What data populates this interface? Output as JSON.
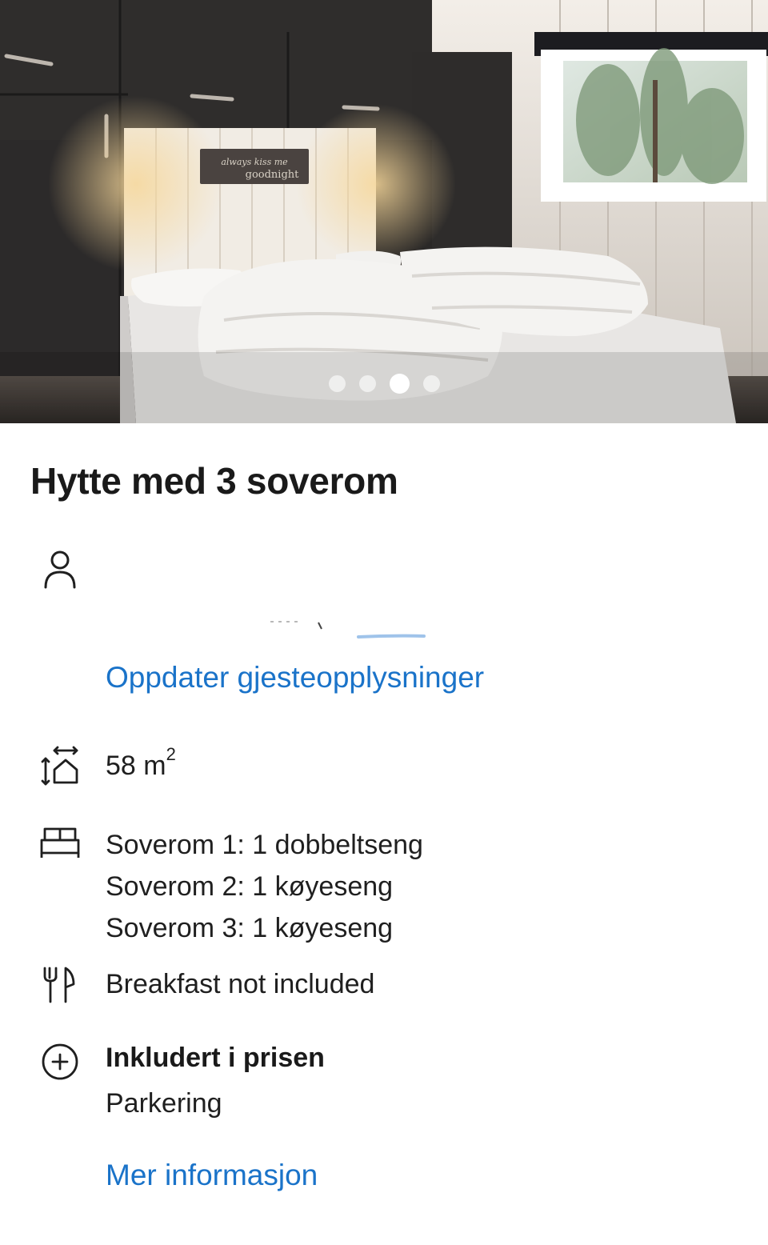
{
  "gallery": {
    "photo_count": 4,
    "active_index": 2,
    "sign_line1": "always kiss me",
    "sign_line2": "goodnight"
  },
  "listing": {
    "title": "Hytte med 3 soverom",
    "area_value": "58 m",
    "area_unit_sup": "2",
    "bedrooms": [
      "Soverom 1: 1 dobbeltseng",
      "Soverom 2: 1 køyeseng",
      "Soverom 3: 1 køyeseng"
    ],
    "meal": "Breakfast not included",
    "included_title": "Inkludert i prisen",
    "included_items": [
      "Parkering"
    ]
  },
  "links": {
    "update_guests": "Oppdater gjesteopplysninger",
    "more_info": "Mer informasjon"
  },
  "colors": {
    "link": "#1a73c9",
    "text": "#1f1f1f"
  },
  "icons": {
    "guest": "person-icon",
    "area": "floor-area-icon",
    "bed": "bed-icon",
    "meal": "cutlery-icon",
    "included": "plus-circle-icon"
  }
}
